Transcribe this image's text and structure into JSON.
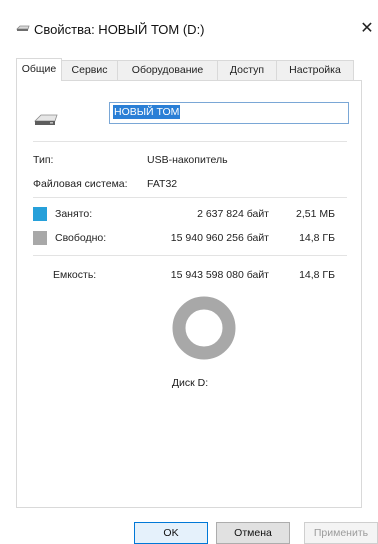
{
  "window": {
    "title": "Свойства: НОВЫЙ ТОМ (D:)",
    "close_label": "✕"
  },
  "tabs": [
    {
      "label": "Общие"
    },
    {
      "label": "Сервис"
    },
    {
      "label": "Оборудование"
    },
    {
      "label": "Доступ"
    },
    {
      "label": "Настройка"
    }
  ],
  "general": {
    "volume_name": "НОВЫЙ ТОМ",
    "type_label": "Тип:",
    "type_value": "USB-накопитель",
    "fs_label": "Файловая система:",
    "fs_value": "FAT32",
    "used_label": "Занято:",
    "used_bytes": "2 637 824 байт",
    "used_short": "2,51 МБ",
    "free_label": "Свободно:",
    "free_bytes": "15 940 960 256 байт",
    "free_short": "14,8 ГБ",
    "capacity_label": "Емкость:",
    "capacity_bytes": "15 943 598 080 байт",
    "capacity_short": "14,8 ГБ",
    "disk_label": "Диск D:"
  },
  "colors": {
    "used": "#26a0da",
    "free": "#a8a8a8"
  },
  "buttons": {
    "ok": "OK",
    "cancel": "Отмена",
    "apply": "Применить"
  }
}
